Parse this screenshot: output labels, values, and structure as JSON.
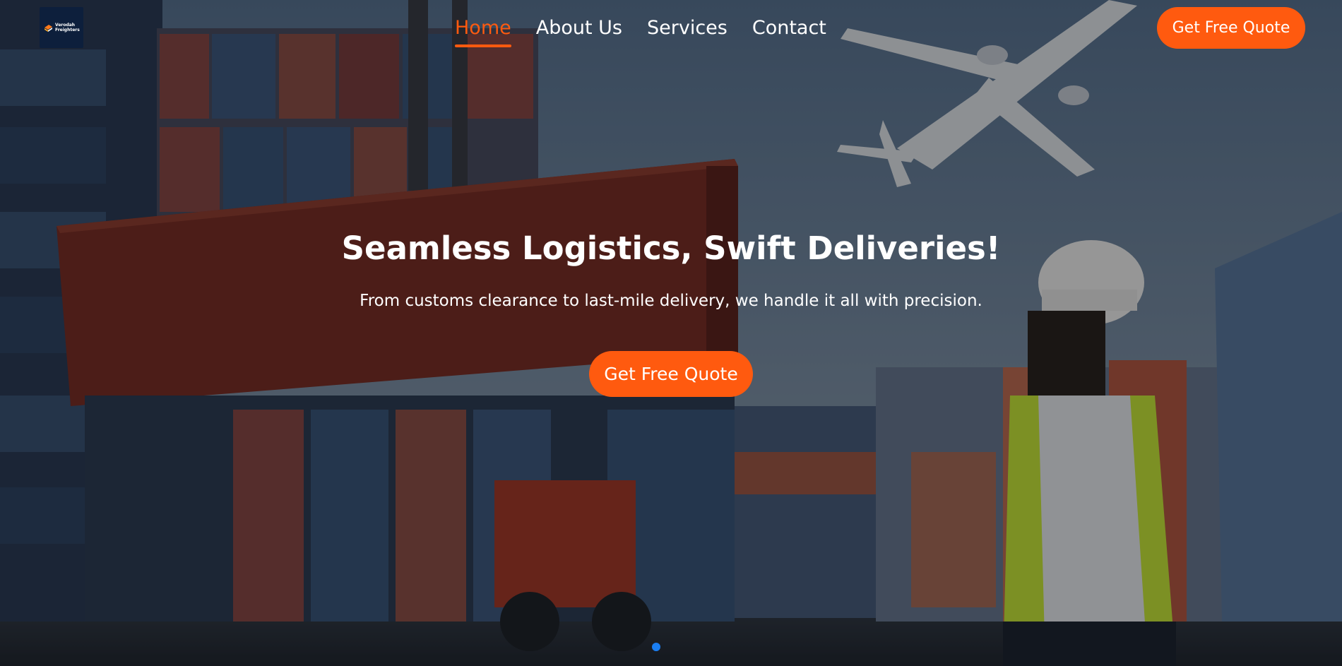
{
  "colors": {
    "accent": "#ff5a0f",
    "logo_background": "#0d1f3c",
    "carousel_active": "#1a7ef2"
  },
  "header": {
    "logo": {
      "text": "Verodah Freighters",
      "icon": "ship-logo-icon"
    },
    "nav": [
      {
        "label": "Home",
        "active": true
      },
      {
        "label": "About Us",
        "active": false
      },
      {
        "label": "Services",
        "active": false
      },
      {
        "label": "Contact",
        "active": false
      }
    ],
    "cta_label": "Get Free Quote"
  },
  "hero": {
    "title": "Seamless Logistics, Swift Deliveries!",
    "subtitle": "From customs clearance to last-mile delivery, we handle it all with precision.",
    "cta_label": "Get Free Quote",
    "background_image": "shipping-containers-airplane-worker-photo"
  },
  "carousel": {
    "slide_count": 1,
    "active_index": 0
  }
}
